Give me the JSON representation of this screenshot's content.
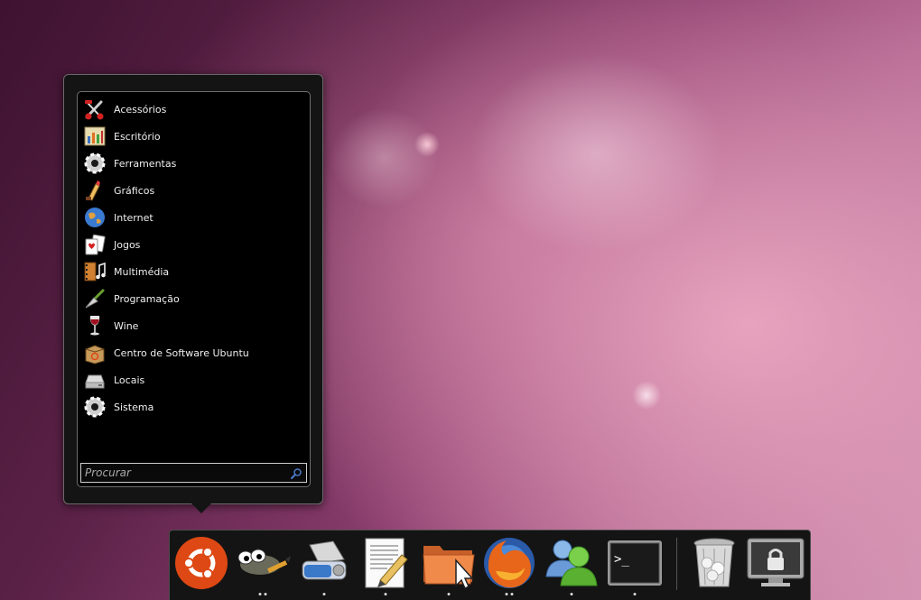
{
  "menu": {
    "items": [
      {
        "label": "Acessórios",
        "icon": "accessories-icon"
      },
      {
        "label": "Escritório",
        "icon": "office-icon"
      },
      {
        "label": "Ferramentas",
        "icon": "tools-gear-icon"
      },
      {
        "label": "Gráficos",
        "icon": "graphics-icon"
      },
      {
        "label": "Internet",
        "icon": "internet-globe-icon"
      },
      {
        "label": "Jogos",
        "icon": "games-cards-icon"
      },
      {
        "label": "Multimédia",
        "icon": "multimedia-icon"
      },
      {
        "label": "Programação",
        "icon": "programming-trowel-icon"
      },
      {
        "label": "Wine",
        "icon": "wine-glass-icon"
      },
      {
        "label": "Centro de Software Ubuntu",
        "icon": "software-center-box-icon"
      },
      {
        "label": "Locais",
        "icon": "places-drive-icon"
      },
      {
        "label": "Sistema",
        "icon": "system-gear-icon"
      }
    ],
    "search_placeholder": "Procurar"
  },
  "dock": {
    "items": [
      {
        "name": "ubuntu-menu",
        "icon": "ubuntu-logo-icon",
        "running": 0
      },
      {
        "name": "gimp",
        "icon": "gimp-icon",
        "running": 2
      },
      {
        "name": "scanner",
        "icon": "scanner-icon",
        "running": 1
      },
      {
        "name": "text-editor",
        "icon": "text-editor-icon",
        "running": 1
      },
      {
        "name": "file-manager",
        "icon": "folder-icon",
        "running": 1
      },
      {
        "name": "firefox",
        "icon": "firefox-icon",
        "running": 2
      },
      {
        "name": "messenger",
        "icon": "messenger-icon",
        "running": 1
      },
      {
        "name": "terminal",
        "icon": "terminal-icon",
        "running": 1
      },
      {
        "name": "trash",
        "icon": "trash-icon",
        "running": 0
      },
      {
        "name": "lock-screen",
        "icon": "lock-screen-icon",
        "running": 0
      }
    ]
  },
  "colors": {
    "ubuntu_orange": "#dd4814",
    "menu_background": "#000000",
    "dock_background": "#141414"
  }
}
